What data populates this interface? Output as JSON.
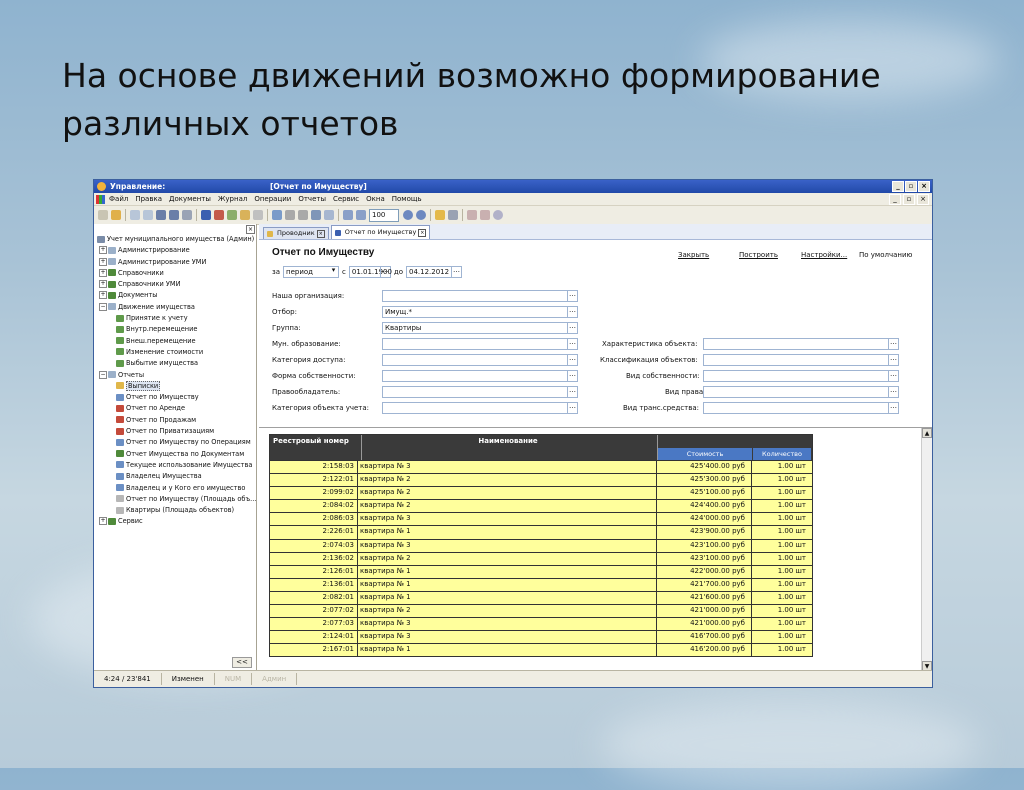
{
  "slide": {
    "title_line1": "На основе движений возможно формирование",
    "title_line2": "различных отчетов"
  },
  "window": {
    "app_title": "Управление:",
    "doc_title": "[Отчет по Имуществу]",
    "controls": [
      "_",
      "▫",
      "×"
    ]
  },
  "menu": {
    "items": [
      "Файл",
      "Правка",
      "Документы",
      "Журнал",
      "Операции",
      "Отчеты",
      "Сервис",
      "Окна",
      "Помощь"
    ]
  },
  "toolbar": {
    "zoom": "100"
  },
  "tree": {
    "root": "Учет муниципального имущества (Админ)",
    "items": [
      "Администрирование",
      "Администрирование УМИ",
      "Справочники",
      "Справочники УМИ",
      "Документы",
      "Движение имущества",
      "Принятие к учету",
      "Внутр.перемещение",
      "Внеш.перемещение",
      "Изменение стоимости",
      "Выбытие имущества",
      "Отчеты",
      "Выписки",
      "Отчет по Имуществу",
      "Отчет по Аренде",
      "Отчет по Продажам",
      "Отчет по Приватизациям",
      "Отчет по Имуществу по Операциям",
      "Отчет Имущества по Документам",
      "Текущее использование Имущества",
      "Владелец Имущества",
      "Владелец и у Кого его имущество",
      "Отчет по Имуществу (Площадь объ...",
      "Квартиры (Площадь объектов)",
      "Сервис"
    ],
    "collapse_label": "<<"
  },
  "tabs": [
    "Проводник",
    "Отчет по Имуществу"
  ],
  "report_form": {
    "title": "Отчет по Имуществу",
    "buttons": [
      "Закрыть",
      "Построить",
      "Настройки...",
      "По умолчанию"
    ],
    "period": {
      "za_label": "за",
      "type": "период",
      "from_label": "с",
      "from": "01.01.1900",
      "to_label": "до",
      "to": "04.12.2012"
    },
    "left_fields": [
      {
        "label": "Наша организация:",
        "value": ""
      },
      {
        "label": "Отбор:",
        "value": "Имущ.*"
      },
      {
        "label": "Группа:",
        "value": "Квартиры"
      },
      {
        "label": "Мун. образование:",
        "value": ""
      },
      {
        "label": "Категория доступа:",
        "value": ""
      },
      {
        "label": "Форма собственности:",
        "value": ""
      },
      {
        "label": "Правообладатель:",
        "value": ""
      },
      {
        "label": "Категория объекта учета:",
        "value": ""
      }
    ],
    "right_fields": [
      {
        "label": "Характеристика объекта:",
        "value": ""
      },
      {
        "label": "Классификация объектов:",
        "value": ""
      },
      {
        "label": "Вид собственности:",
        "value": ""
      },
      {
        "label": "Вид права:",
        "value": ""
      },
      {
        "label": "Вид транс.средства:",
        "value": ""
      }
    ]
  },
  "report_table": {
    "headers": [
      "Реестровый номер",
      "Наименование",
      "Стоимость",
      "Количество"
    ],
    "rows": [
      [
        "2:158:03",
        "квартира № 3",
        "425'400.00  руб",
        "1.00  шт"
      ],
      [
        "2:122:01",
        "квартира № 2",
        "425'300.00  руб",
        "1.00  шт"
      ],
      [
        "2:099:02",
        "квартира № 2",
        "425'100.00  руб",
        "1.00  шт"
      ],
      [
        "2:084:02",
        "квартира № 2",
        "424'400.00  руб",
        "1.00  шт"
      ],
      [
        "2:086:03",
        "квартира № 3",
        "424'000.00  руб",
        "1.00  шт"
      ],
      [
        "2:226:01",
        "квартира № 1",
        "423'900.00  руб",
        "1.00  шт"
      ],
      [
        "2:074:03",
        "квартира № 3",
        "423'100.00  руб",
        "1.00  шт"
      ],
      [
        "2:136:02",
        "квартира № 2",
        "423'100.00  руб",
        "1.00  шт"
      ],
      [
        "2:126:01",
        "квартира № 1",
        "422'000.00  руб",
        "1.00  шт"
      ],
      [
        "2:136:01",
        "квартира № 1",
        "421'700.00  руб",
        "1.00  шт"
      ],
      [
        "2:082:01",
        "квартира № 1",
        "421'600.00  руб",
        "1.00  шт"
      ],
      [
        "2:077:02",
        "квартира № 2",
        "421'000.00  руб",
        "1.00  шт"
      ],
      [
        "2:077:03",
        "квартира № 3",
        "421'000.00  руб",
        "1.00  шт"
      ],
      [
        "2:124:01",
        "квартира № 3",
        "416'700.00  руб",
        "1.00  шт"
      ],
      [
        "2:167:01",
        "квартира № 1",
        "416'200.00  руб",
        "1.00  шт"
      ]
    ]
  },
  "status": {
    "position": "4:24 / 23'841",
    "state": "Изменен",
    "mode1": "NUM",
    "mode2": "Админ"
  },
  "colors": {
    "title_bar": "#2a55b8",
    "row_fill": "#ffff9c",
    "header_fill": "#3a3a3a",
    "sub_header": "#4a78c4"
  }
}
